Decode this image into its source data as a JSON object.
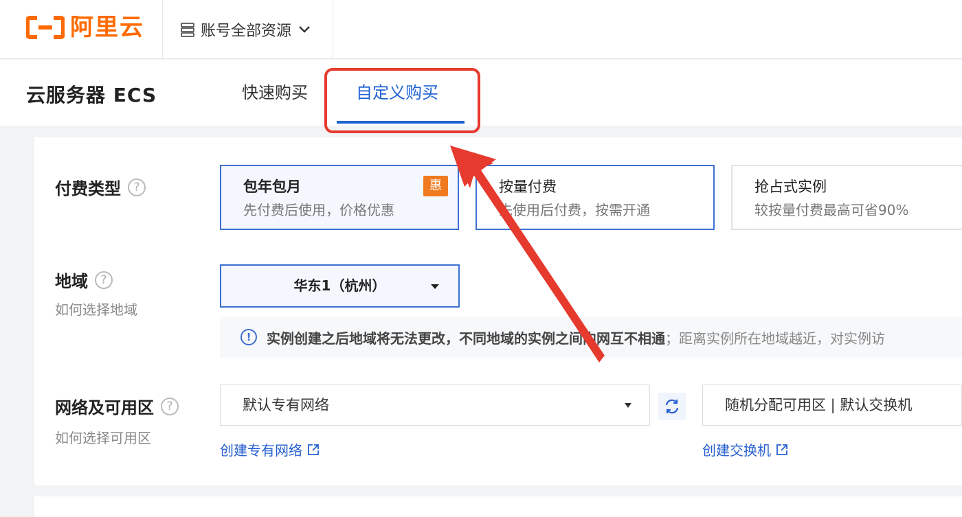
{
  "header": {
    "logo_text": "阿里云",
    "account_scope": "账号全部资源",
    "brand_color": "#ff6a00"
  },
  "subheader": {
    "page_title": "云服务器 ECS",
    "tabs": [
      {
        "label": "快速购买",
        "active": false
      },
      {
        "label": "自定义购买",
        "active": true
      }
    ]
  },
  "billing": {
    "label": "付费类型",
    "options": [
      {
        "title": "包年包月",
        "desc": "先付费后使用，价格优惠",
        "badge": "惠",
        "selected": true
      },
      {
        "title": "按量付费",
        "desc": "先使用后付费，按需开通",
        "selected": false
      },
      {
        "title": "抢占式实例",
        "desc": "较按量付费最高可省90%",
        "selected": false
      }
    ]
  },
  "region": {
    "label": "地域",
    "sub": "如何选择地域",
    "selected": "华东1（杭州）",
    "notice_strong": "实例创建之后地域将无法更改，不同地域的实例之间内网互不相通",
    "notice_rest": "；距离实例所在地域越近，对实例访"
  },
  "network": {
    "label": "网络及可用区",
    "sub": "如何选择可用区",
    "vpc_value": "默认专有网络",
    "zone_value": "随机分配可用区 | 默认交换机",
    "create_vpc_link": "创建专有网络",
    "create_switch_link": "创建交换机"
  },
  "colors": {
    "accent": "#1f63d6",
    "annotation": "#e63a2e",
    "badge": "#ef7a1f"
  }
}
